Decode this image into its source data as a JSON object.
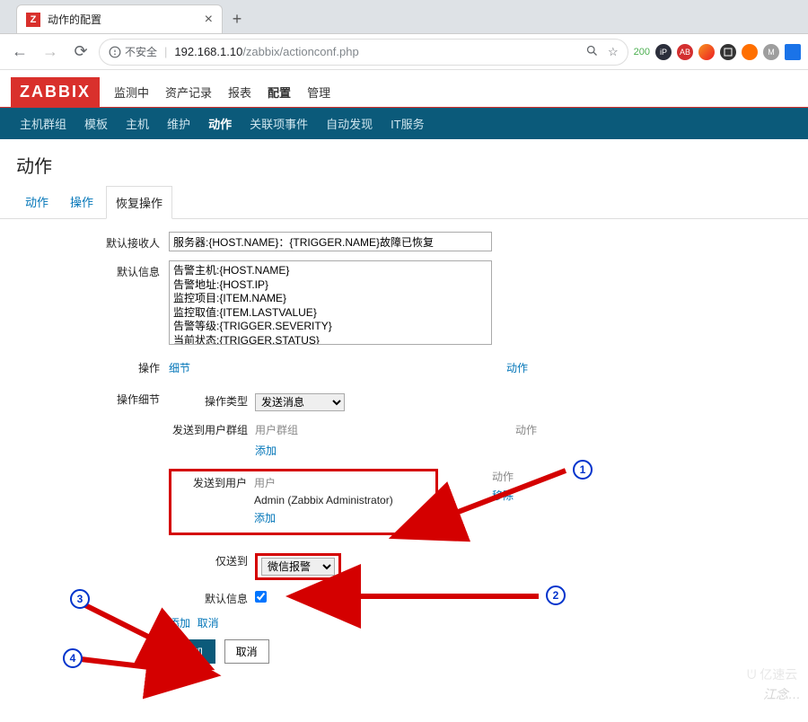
{
  "browser": {
    "tab_title": "动作的配置",
    "tab_favicon_text": "Z",
    "insecure_label": "不安全",
    "url_host": "192.168.1.10",
    "url_path": "/zabbix/actionconf.php",
    "quota_label": "200"
  },
  "header": {
    "logo": "ZABBIX",
    "menu1": [
      "监测中",
      "资产记录",
      "报表",
      "配置",
      "管理"
    ],
    "menu1_active_index": 3,
    "sub": [
      "主机群组",
      "模板",
      "主机",
      "维护",
      "动作",
      "关联项事件",
      "自动发现",
      "IT服务"
    ],
    "sub_active_index": 4
  },
  "page": {
    "title": "动作",
    "tabs3": [
      "动作",
      "操作",
      "恢复操作"
    ],
    "tab3_active_index": 2
  },
  "form": {
    "default_subject_label": "默认接收人",
    "default_subject_value": "服务器:{HOST.NAME}：{TRIGGER.NAME}故障已恢复",
    "default_message_label": "默认信息",
    "default_message_value": "告警主机:{HOST.NAME}\n告警地址:{HOST.IP}\n监控项目:{ITEM.NAME}\n监控取值:{ITEM.LASTVALUE}\n告警等级:{TRIGGER.SEVERITY}\n当前状态:{TRIGGER.STATUS}",
    "operations_label": "操作",
    "ops_col_detail": "细节",
    "ops_col_action": "动作",
    "op_detail_label": "操作细节",
    "op_type_label": "操作类型",
    "op_type_value": "发送消息",
    "send_to_groups_label": "发送到用户群组",
    "groups_col_header": "用户群组",
    "groups_action_header": "动作",
    "add_link": "添加",
    "send_to_users_label": "发送到用户",
    "users_col_header": "用户",
    "user_row": "Admin (Zabbix Administrator)",
    "remove_link": "移除",
    "send_only_to_label": "仅送到",
    "send_only_to_value": "微信报警",
    "default_msg_checkbox_label": "默认信息",
    "mini_add": "添加",
    "mini_cancel": "取消",
    "btn_add": "添加",
    "btn_cancel": "取消"
  },
  "annotations": {
    "m1": "1",
    "m2": "2",
    "m3": "3",
    "m4": "4"
  },
  "watermark": "江念…",
  "wm_brand": "亿速云"
}
